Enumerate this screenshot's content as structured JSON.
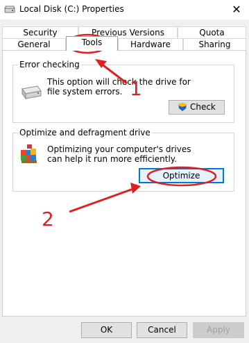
{
  "window": {
    "title": "Local Disk (C:) Properties"
  },
  "tabs": {
    "row1": [
      "Security",
      "Previous Versions",
      "Quota"
    ],
    "row2": [
      "General",
      "Tools",
      "Hardware",
      "Sharing"
    ],
    "active": "Tools"
  },
  "error_checking": {
    "group_label": "Error checking",
    "description": "This option will check the drive for file system errors.",
    "button_label": "Check"
  },
  "optimize": {
    "group_label": "Optimize and defragment drive",
    "description": "Optimizing your computer's drives can help it run more efficiently.",
    "button_label": "Optimize"
  },
  "footer": {
    "ok_label": "OK",
    "cancel_label": "Cancel",
    "apply_label": "Apply"
  },
  "annotations": {
    "step1": "1",
    "step2": "2",
    "color": "#e02020"
  }
}
